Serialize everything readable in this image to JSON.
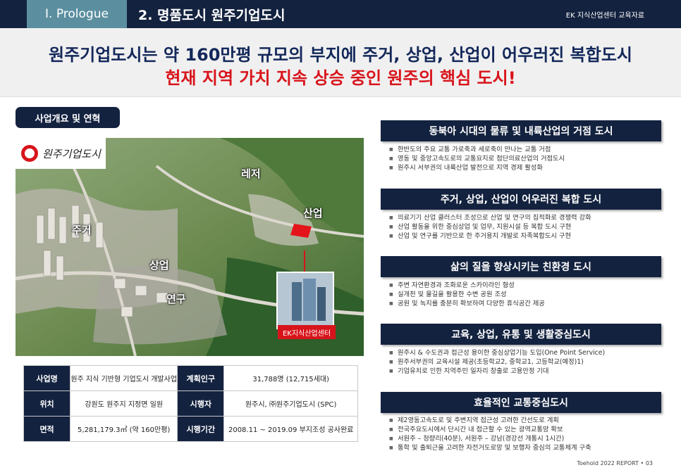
{
  "header": {
    "section_tab": "Ⅰ. Prologue",
    "current_title": "2. 명품도시 원주기업도시",
    "brand": "EK 지식산업센터 교육자료"
  },
  "headline": {
    "line1": "원주기업도시는 약 160만평 규모의 부지에 주거, 상업, 산업이 어우러진 복합도시",
    "line2": "현재 지역 가치 지속 상승 중인 원주의 핵심 도시!"
  },
  "overview": {
    "pill": "사업개요 및 연혁",
    "logo_text": "원주기업도시",
    "map_labels": {
      "leisure": "레저",
      "industry": "산업",
      "residence": "주거",
      "commerce": "상업",
      "research": "연구"
    },
    "center_label": "EK지식산업센터"
  },
  "table": [
    {
      "h1": "사업명",
      "v1": "원주 지식 기반형 기업도시 개발사업",
      "h2": "계획인구",
      "v2": "31,788명 (12,715세대)"
    },
    {
      "h1": "위치",
      "v1": "강원도 원주지 지정면 일원",
      "h2": "시행자",
      "v2": "원주시, ㈜원주기업도시 (SPC)"
    },
    {
      "h1": "면적",
      "v1": "5,281,179.3㎡ (약 160만평)",
      "h2": "시행기간",
      "v2": "2008.11 ~ 2019.09 부지조성 공사완료"
    }
  ],
  "sections": [
    {
      "title": "동북아 시대의 물류 및 내륙산업의 거점 도시",
      "items": [
        "한반도의 주요 교통 가로축과 세로축이 만나는 교통 거점",
        "영동 및 중앙고속도로의 교통요지로 첨단의료산업의 거점도시",
        "원주시 서부권의 내륙산업 발전으로 지역 경제 활성화"
      ]
    },
    {
      "title": "주거, 상업, 산업이 어우러진 복합 도시",
      "items": [
        "의료기기 산업 클러스터 조성으로 산업 및 연구의 집적화로 경쟁력 강화",
        "산업 활동을 위한 중심상업 및 업무, 지원시설 등 복합 도시 구현",
        "산업 및 연구를 기반으로 한 주거용지 개발로 자족복합도시 구현"
      ]
    },
    {
      "title": "삶의 질을 향상시키는 친환경 도시",
      "items": [
        "주변 자연환경과 조화로운 스카이라인 형성",
        "실개천 및 물길을 활용한 수변 공원 조성",
        "공원 및 녹지를 충분히 확보하여 다양한 휴식공간 제공"
      ]
    },
    {
      "title": "교육, 상업, 유통 및 생활중심도시",
      "items": [
        "원주시 & 수도권과 접근성 용이한 중심상업기능 도입(One Point Service)",
        "원주서부권의 교육시설 제공(초등학교2, 중학교1, 고등학교(예정)1)",
        "기업유치로 인한 지역주민 일자리 창출로 고용안정 기대"
      ]
    },
    {
      "title": "효율적인 교통중심도시",
      "items": [
        "제2영동고속도로 및 주변지역 접근성 고려한 간선도로 계획",
        "전국주요도시에서 단시간 내 접근할 수 있는 광역교통망 확보",
        "서원주 – 청량리(40분), 서원주 – 강남(경강선 개통시 1시간)",
        "통학 및 출퇴근을 고려한 자전거도로망 및 보행자 중심의 교통체계 구축"
      ]
    }
  ],
  "footer": "Toehold 2022 REPORT • 03"
}
